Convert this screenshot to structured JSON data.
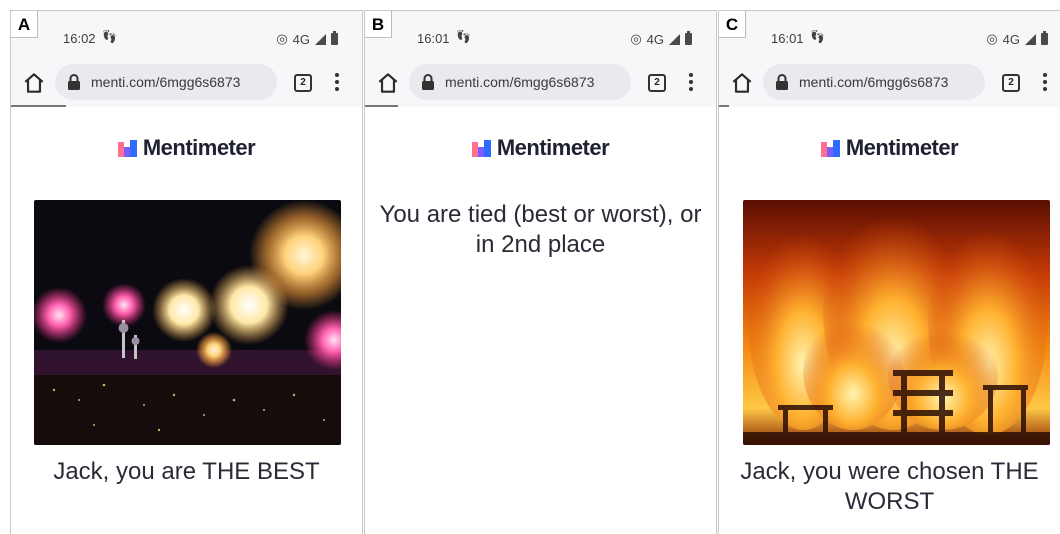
{
  "panels": [
    {
      "letter": "A",
      "status_time": "16:02",
      "network": "4G",
      "url": "menti.com/6mgg6s6873",
      "tab_count": "2",
      "brand": "Mentimeter",
      "image": "fireworks",
      "caption": "Jack, you are THE BEST"
    },
    {
      "letter": "B",
      "status_time": "16:01",
      "network": "4G",
      "url": "menti.com/6mgg6s6873",
      "tab_count": "2",
      "brand": "Mentimeter",
      "caption": "You are tied (best or worst), or in 2nd place"
    },
    {
      "letter": "C",
      "status_time": "16:01",
      "network": "4G",
      "url": "menti.com/6mgg6s6873",
      "tab_count": "2",
      "brand": "Mentimeter",
      "image": "fire",
      "caption": "Jack, you were chosen THE WORST"
    }
  ],
  "icons": {
    "home": "home-icon",
    "lock": "lock-icon",
    "tabs": "tabs-icon",
    "menu": "menu-icon",
    "signal": "signal-icon",
    "battery": "battery-icon",
    "hotspot": "hotspot-icon"
  },
  "colors": {
    "brand_text": "#1f2030",
    "chrome_bg": "#f7f7f9",
    "url_pill": "#e8eaee"
  }
}
